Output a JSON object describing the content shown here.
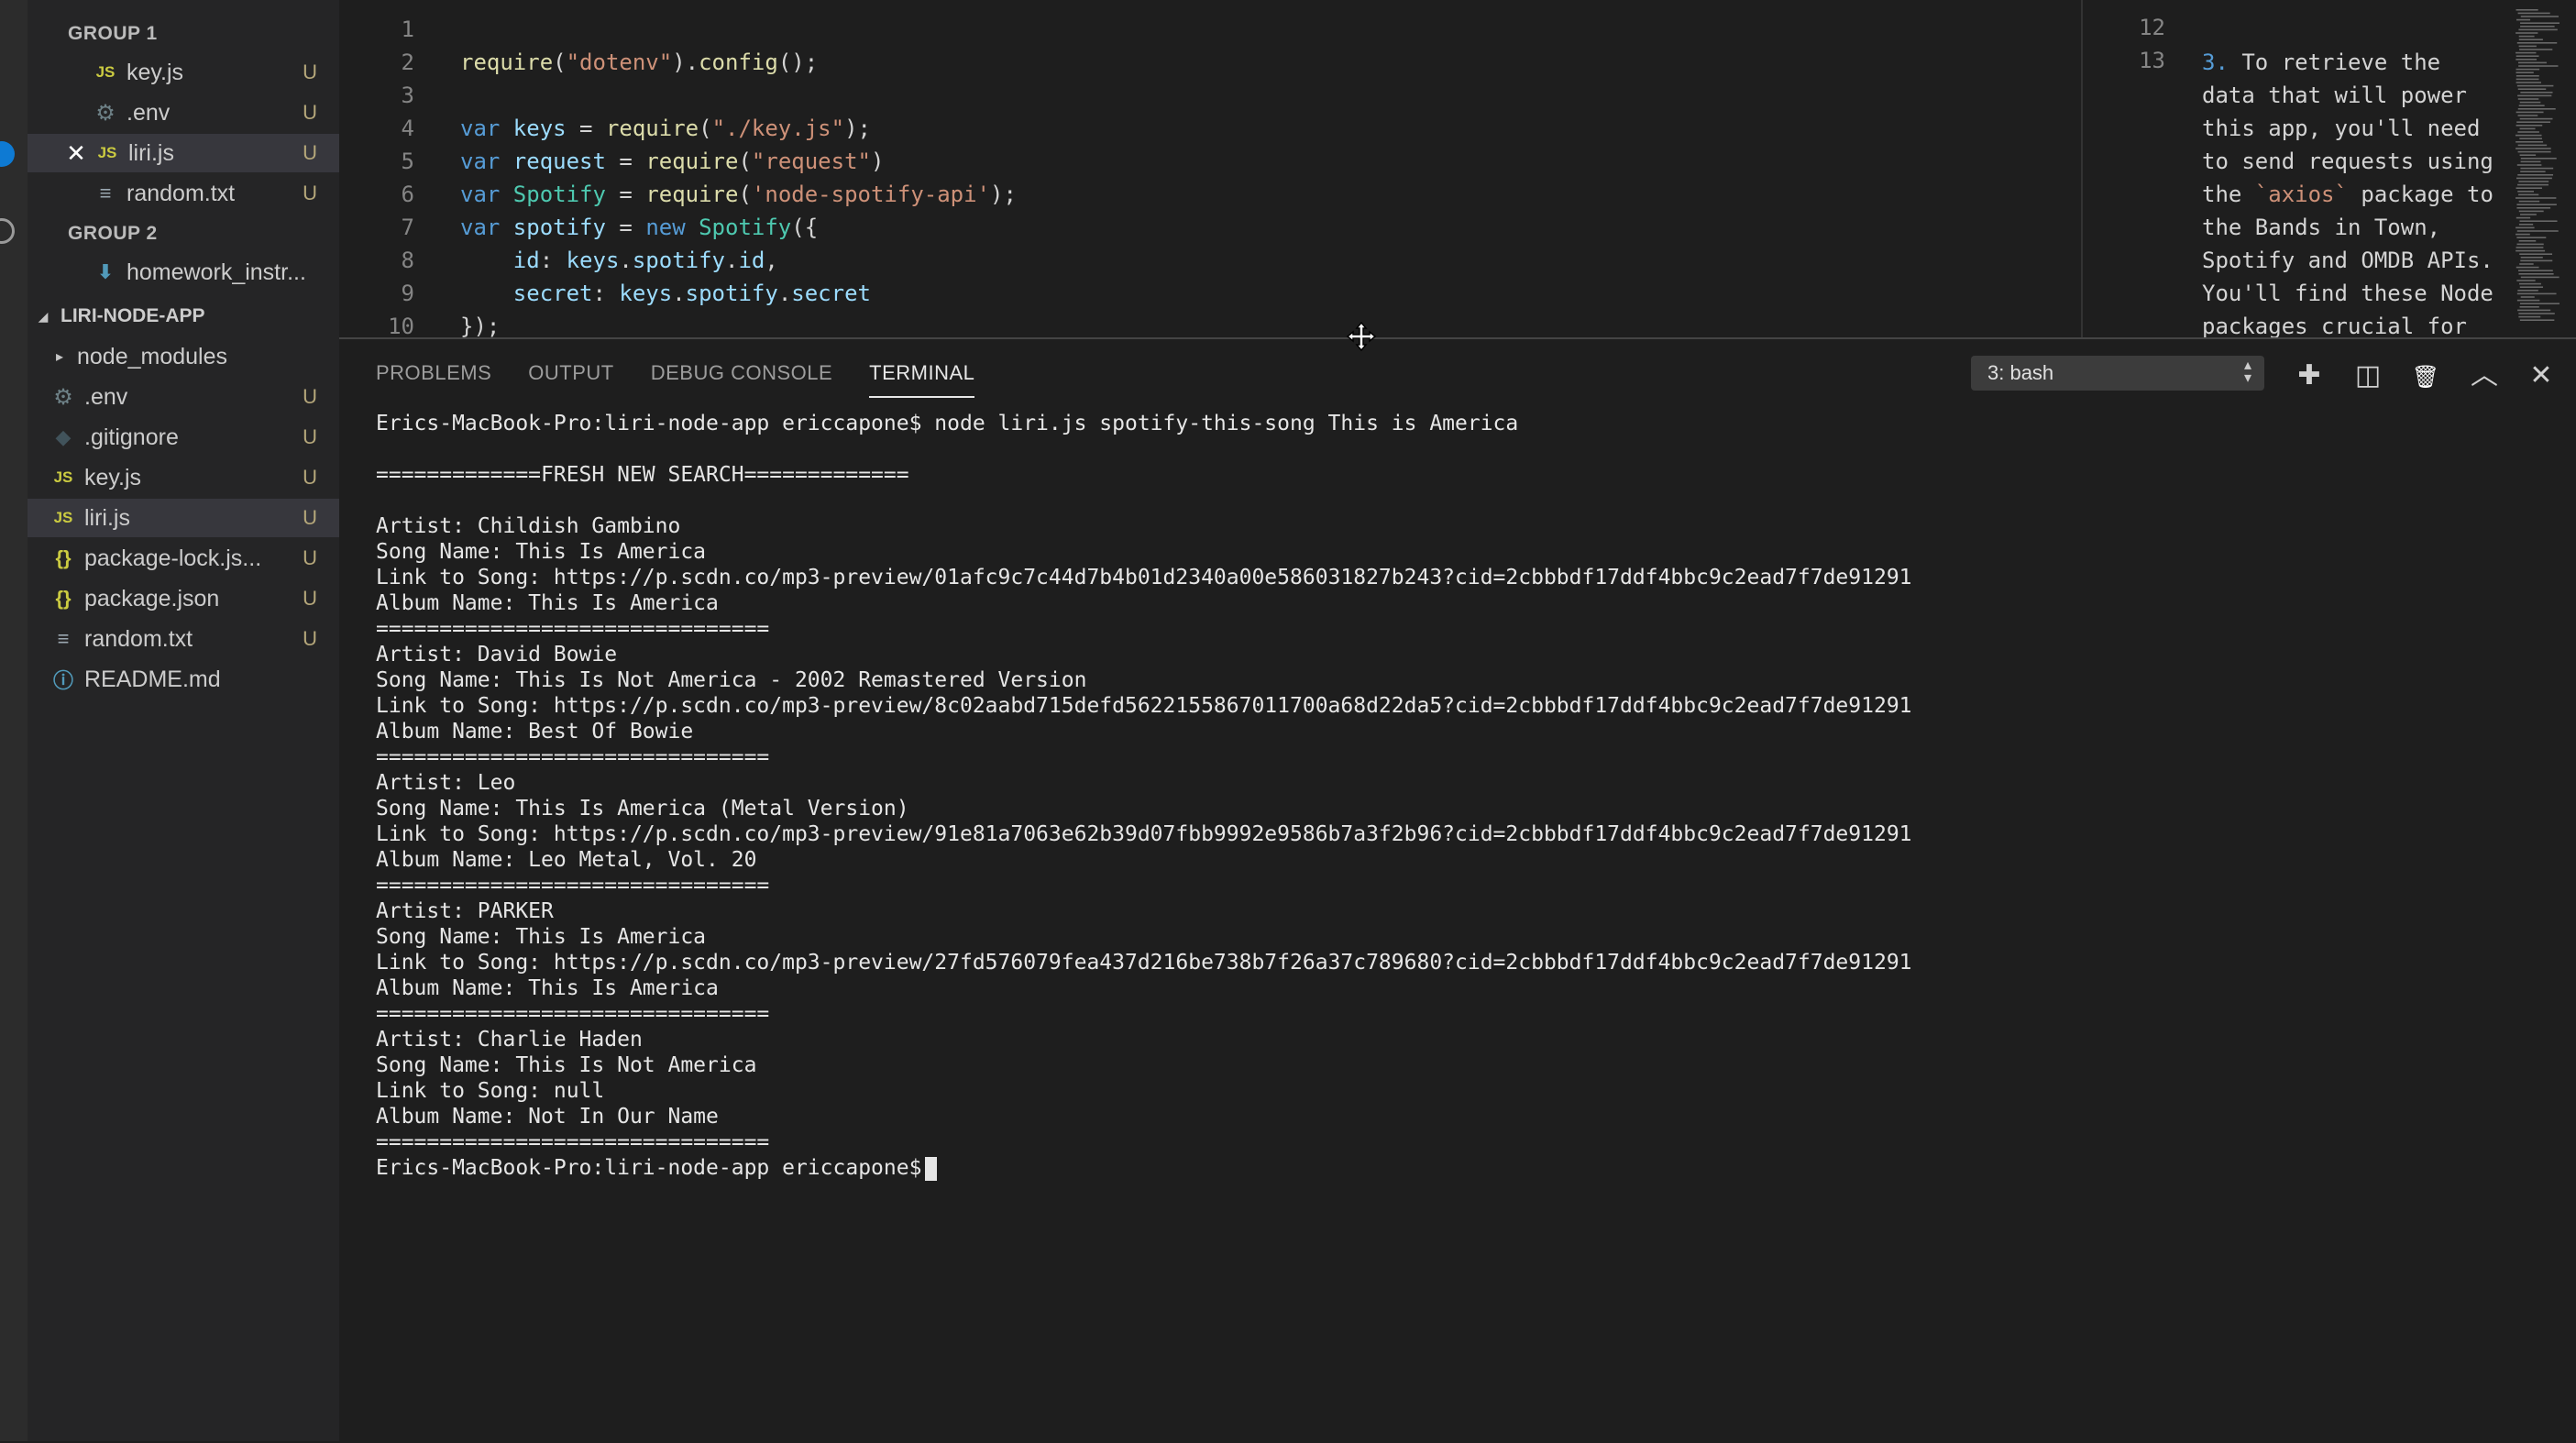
{
  "sidebar": {
    "groups": [
      {
        "label": "GROUP 1",
        "files": [
          {
            "icon": "JS",
            "name": "key.js",
            "status": "U"
          },
          {
            "icon": "⚙",
            "name": ".env",
            "status": "U"
          },
          {
            "icon": "JS",
            "name": "liri.js",
            "status": "U",
            "close": "✕"
          },
          {
            "icon": "≡",
            "name": "random.txt",
            "status": "U"
          }
        ]
      },
      {
        "label": "GROUP 2",
        "files": [
          {
            "icon": "⬇",
            "name": "homework_instr...",
            "status": ""
          }
        ]
      }
    ],
    "project": {
      "label": "LIRI-NODE-APP",
      "items": [
        {
          "icon": "▸",
          "name": "node_modules",
          "status": ""
        },
        {
          "icon": "⚙",
          "name": ".env",
          "status": "U"
        },
        {
          "icon": "◆",
          "name": ".gitignore",
          "status": "U"
        },
        {
          "icon": "JS",
          "name": "key.js",
          "status": "U"
        },
        {
          "icon": "JS",
          "name": "liri.js",
          "status": "U"
        },
        {
          "icon": "{}",
          "name": "package-lock.js...",
          "status": "U"
        },
        {
          "icon": "{}",
          "name": "package.json",
          "status": "U"
        },
        {
          "icon": "≡",
          "name": "random.txt",
          "status": "U"
        },
        {
          "icon": "ⓘ",
          "name": "README.md",
          "status": ""
        }
      ]
    }
  },
  "editor": {
    "line_numbers": [
      "1",
      "2",
      "3",
      "4",
      "5",
      "6",
      "7",
      "8",
      "9",
      "10"
    ],
    "lines": [
      [],
      [
        {
          "t": "fn",
          "v": "require"
        },
        {
          "t": "p",
          "v": "("
        },
        {
          "t": "str",
          "v": "\"dotenv\""
        },
        {
          "t": "p",
          "v": ")."
        },
        {
          "t": "fn",
          "v": "config"
        },
        {
          "t": "p",
          "v": "();"
        }
      ],
      [],
      [
        {
          "t": "kw",
          "v": "var "
        },
        {
          "t": "var",
          "v": "keys"
        },
        {
          "t": "p",
          "v": " = "
        },
        {
          "t": "fn",
          "v": "require"
        },
        {
          "t": "p",
          "v": "("
        },
        {
          "t": "str",
          "v": "\"./key.js\""
        },
        {
          "t": "p",
          "v": ");"
        }
      ],
      [
        {
          "t": "kw",
          "v": "var "
        },
        {
          "t": "var",
          "v": "request"
        },
        {
          "t": "p",
          "v": " = "
        },
        {
          "t": "fn",
          "v": "require"
        },
        {
          "t": "p",
          "v": "("
        },
        {
          "t": "str",
          "v": "\"request\""
        },
        {
          "t": "p",
          "v": ")"
        }
      ],
      [
        {
          "t": "kw",
          "v": "var "
        },
        {
          "t": "cls",
          "v": "Spotify"
        },
        {
          "t": "p",
          "v": " = "
        },
        {
          "t": "fn",
          "v": "require"
        },
        {
          "t": "p",
          "v": "("
        },
        {
          "t": "str",
          "v": "'node-spotify-api'"
        },
        {
          "t": "p",
          "v": ");"
        }
      ],
      [
        {
          "t": "kw",
          "v": "var "
        },
        {
          "t": "var",
          "v": "spotify"
        },
        {
          "t": "p",
          "v": " = "
        },
        {
          "t": "kw",
          "v": "new "
        },
        {
          "t": "cls",
          "v": "Spotify"
        },
        {
          "t": "p",
          "v": "({"
        }
      ],
      [
        {
          "t": "p",
          "v": "    "
        },
        {
          "t": "var",
          "v": "id"
        },
        {
          "t": "p",
          "v": ": "
        },
        {
          "t": "var",
          "v": "keys"
        },
        {
          "t": "p",
          "v": "."
        },
        {
          "t": "var",
          "v": "spotify"
        },
        {
          "t": "p",
          "v": "."
        },
        {
          "t": "var",
          "v": "id"
        },
        {
          "t": "p",
          "v": ","
        }
      ],
      [
        {
          "t": "p",
          "v": "    "
        },
        {
          "t": "var",
          "v": "secret"
        },
        {
          "t": "p",
          "v": ": "
        },
        {
          "t": "var",
          "v": "keys"
        },
        {
          "t": "p",
          "v": "."
        },
        {
          "t": "var",
          "v": "spotify"
        },
        {
          "t": "p",
          "v": "."
        },
        {
          "t": "var",
          "v": "secret"
        }
      ],
      [
        {
          "t": "p",
          "v": "});"
        }
      ]
    ]
  },
  "right_pane": {
    "line_numbers": [
      "12",
      "13"
    ],
    "text_parts": [
      {
        "t": "num",
        "v": "3."
      },
      {
        "t": "p",
        "v": " To retrieve the data that will power this app, you'll need to send requests using the "
      },
      {
        "t": "tick",
        "v": "`axios`"
      },
      {
        "t": "p",
        "v": " package to the Bands in Town, Spotify and OMDB APIs. You'll find these Node packages crucial for"
      }
    ]
  },
  "panel": {
    "tabs": [
      {
        "label": "PROBLEMS",
        "active": false
      },
      {
        "label": "OUTPUT",
        "active": false
      },
      {
        "label": "DEBUG CONSOLE",
        "active": false
      },
      {
        "label": "TERMINAL",
        "active": true
      }
    ],
    "terminal_select": "3: bash",
    "buttons": [
      {
        "name": "new-terminal-button",
        "icon": "plus-icon",
        "glyph": "✚"
      },
      {
        "name": "split-terminal-button",
        "icon": "split-icon",
        "glyph": "◫"
      },
      {
        "name": "kill-terminal-button",
        "icon": "trash-icon",
        "glyph": "🗑"
      },
      {
        "name": "maximize-panel-button",
        "icon": "chevron-up-icon",
        "glyph": "︿"
      },
      {
        "name": "close-panel-button",
        "icon": "close-icon",
        "glyph": "✕"
      }
    ]
  },
  "terminal": {
    "lines": [
      "Erics-MacBook-Pro:liri-node-app ericcapone$ node liri.js spotify-this-song This is America",
      "",
      "=============FRESH NEW SEARCH=============",
      "",
      "Artist: Childish Gambino",
      "Song Name: This Is America",
      "Link to Song: https://p.scdn.co/mp3-preview/01afc9c7c44d7b4b01d2340a00e586031827b243?cid=2cbbbdf17ddf4bbc9c2ead7f7de91291",
      "Album Name: This Is America",
      "===============================",
      "Artist: David Bowie",
      "Song Name: This Is Not America - 2002 Remastered Version",
      "Link to Song: https://p.scdn.co/mp3-preview/8c02aabd715defd5622155867011700a68d22da5?cid=2cbbbdf17ddf4bbc9c2ead7f7de91291",
      "Album Name: Best Of Bowie",
      "===============================",
      "Artist: Leo",
      "Song Name: This Is America (Metal Version)",
      "Link to Song: https://p.scdn.co/mp3-preview/91e81a7063e62b39d07fbb9992e9586b7a3f2b96?cid=2cbbbdf17ddf4bbc9c2ead7f7de91291",
      "Album Name: Leo Metal, Vol. 20",
      "===============================",
      "Artist: PARKER",
      "Song Name: This Is America",
      "Link to Song: https://p.scdn.co/mp3-preview/27fd576079fea437d216be738b7f26a37c789680?cid=2cbbbdf17ddf4bbc9c2ead7f7de91291",
      "Album Name: This Is America",
      "===============================",
      "Artist: Charlie Haden",
      "Song Name: This Is Not America",
      "Link to Song: null",
      "Album Name: Not In Our Name",
      "==============================="
    ],
    "prompt": "Erics-MacBook-Pro:liri-node-app ericcapone$"
  }
}
